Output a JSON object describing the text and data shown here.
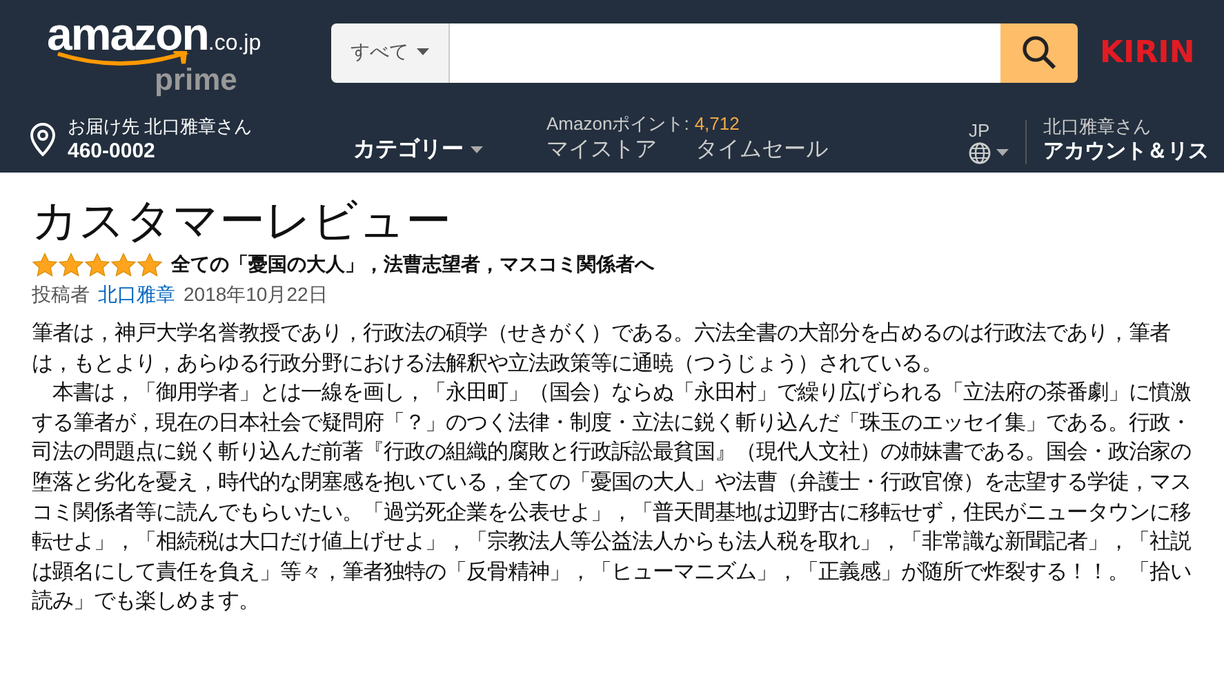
{
  "header": {
    "logo": {
      "wordmark": "amazon",
      "domain": ".co.jp",
      "tier": "prime"
    },
    "search": {
      "category": "すべて"
    },
    "promo": "KIRIN",
    "delivery": {
      "label": "お届け先 北口雅章さん",
      "postcode": "460-0002"
    },
    "category_menu": "カテゴリー",
    "points": {
      "label": "Amazonポイント:",
      "value": "4,712"
    },
    "links": [
      "マイストア",
      "タイムセール"
    ],
    "language": "JP",
    "account": {
      "greeting": "北口雅章さん",
      "label": "アカウント＆リス"
    }
  },
  "review": {
    "page_title": "カスタマーレビュー",
    "stars": 5,
    "headline": "全ての「憂国の大人」，法曹志望者，マスコミ関係者へ",
    "author_label": "投稿者",
    "author": "北口雅章",
    "date": "2018年10月22日",
    "paragraphs": [
      "筆者は，神戸大学名誉教授であり，行政法の碩学（せきがく）である。六法全書の大部分を占めるのは行政法であり，筆者は，もとより，あらゆる行政分野における法解釈や立法政策等に通暁（つうじょう）されている。",
      "　本書は，「御用学者」とは一線を画し，「永田町」（国会）ならぬ「永田村」で繰り広げられる「立法府の茶番劇」に憤激する筆者が，現在の日本社会で疑問府「？」のつく法律・制度・立法に鋭く斬り込んだ「珠玉のエッセイ集」である。行政・司法の問題点に鋭く斬り込んだ前著『行政の組織的腐敗と行政訴訟最貧国』（現代人文社）の姉妹書である。国会・政治家の堕落と劣化を憂え，時代的な閉塞感を抱いている，全ての「憂国の大人」や法曹（弁護士・行政官僚）を志望する学徒，マスコミ関係者等に読んでもらいたい。「過労死企業を公表せよ」，「普天間基地は辺野古に移転せず，住民がニュータウンに移転せよ」，「相続税は大口だけ値上げせよ」，「宗教法人等公益法人からも法人税を取れ」，「非常識な新聞記者」，「社説は顕名にして責任を負え」等々，筆者独特の「反骨精神」，「ヒューマニズム」，「正義感」が随所で炸裂する！！。「拾い読み」でも楽しめます。"
    ]
  }
}
